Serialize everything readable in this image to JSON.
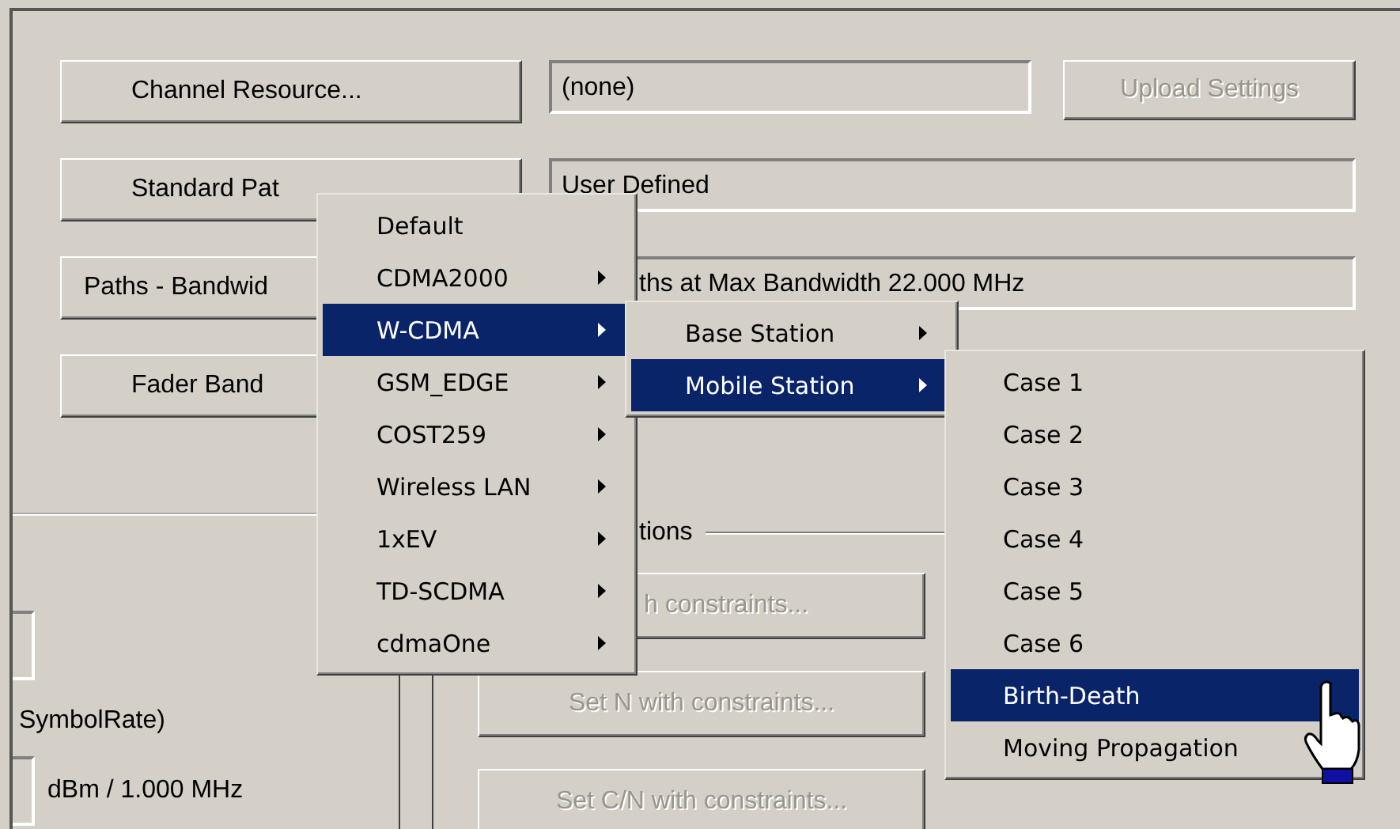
{
  "top_rows": [
    {
      "button": {
        "label": "Channel Resource...",
        "disabled": false
      },
      "field": "(none)",
      "side_button": {
        "label": "Upload Settings",
        "disabled": true
      }
    },
    {
      "button": {
        "label": "Standard Pat",
        "disabled": false
      },
      "field": "User Defined"
    },
    {
      "button": {
        "label": "Paths - Bandwid",
        "disabled": false
      },
      "field": "ths at Max Bandwidth 22.000 MHz"
    },
    {
      "button": {
        "label": "Fader Band",
        "disabled": false
      }
    }
  ],
  "left_panel": {
    "labels": [
      "SymbolRate)",
      "dBm / 1.000 MHz"
    ]
  },
  "options_group": {
    "title": "tions",
    "buttons": [
      {
        "label": "h constraints...",
        "disabled": true
      },
      {
        "label": "Set N with constraints...",
        "disabled": true
      },
      {
        "label": "Set C/N with constraints...",
        "disabled": true
      }
    ]
  },
  "menu": {
    "items": [
      {
        "label": "Default",
        "has_submenu": false,
        "selected": false
      },
      {
        "label": "CDMA2000",
        "has_submenu": true,
        "selected": false
      },
      {
        "label": "W-CDMA",
        "has_submenu": true,
        "selected": true
      },
      {
        "label": "GSM_EDGE",
        "has_submenu": true,
        "selected": false
      },
      {
        "label": "COST259",
        "has_submenu": true,
        "selected": false
      },
      {
        "label": "Wireless LAN",
        "has_submenu": true,
        "selected": false
      },
      {
        "label": "1xEV",
        "has_submenu": true,
        "selected": false
      },
      {
        "label": "TD-SCDMA",
        "has_submenu": true,
        "selected": false
      },
      {
        "label": "cdmaOne",
        "has_submenu": true,
        "selected": false
      }
    ]
  },
  "submenu": {
    "items": [
      {
        "label": "Base Station",
        "has_submenu": true,
        "selected": false
      },
      {
        "label": "Mobile Station",
        "has_submenu": true,
        "selected": true
      }
    ]
  },
  "submenu_2": {
    "items": [
      {
        "label": "Case 1",
        "selected": false
      },
      {
        "label": "Case 2",
        "selected": false
      },
      {
        "label": "Case 3",
        "selected": false
      },
      {
        "label": "Case 4",
        "selected": false
      },
      {
        "label": "Case 5",
        "selected": false
      },
      {
        "label": "Case 6",
        "selected": false
      },
      {
        "label": "Birth-Death",
        "selected": true
      },
      {
        "label": "Moving Propagation",
        "selected": false
      }
    ]
  }
}
